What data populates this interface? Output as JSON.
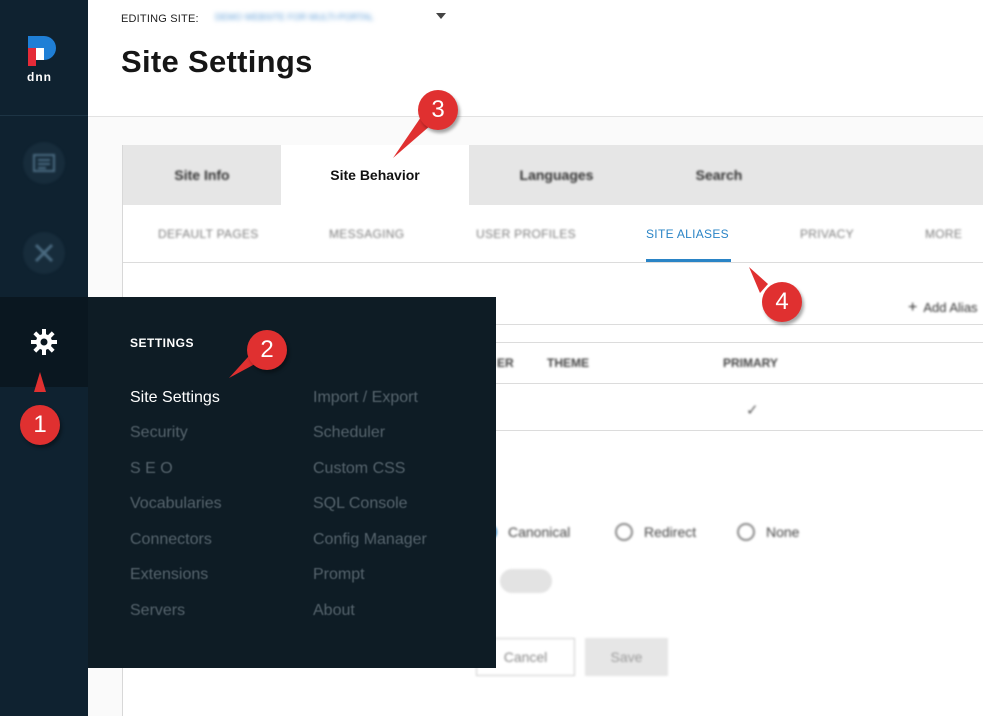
{
  "header": {
    "editing_label": "EDITING SITE:",
    "site_name": "DEMO WEBSITE FOR MULTI-PORTAL",
    "page_title": "Site Settings"
  },
  "logo": {
    "text": "DNN"
  },
  "rail": {
    "items": [
      {
        "icon": "content-pages-icon"
      },
      {
        "icon": "tools-icon"
      },
      {
        "icon": "gear-icon"
      }
    ]
  },
  "tabs": [
    "Site Info",
    "Site Behavior",
    "Languages",
    "Search"
  ],
  "subtabs": [
    "DEFAULT PAGES",
    "MESSAGING",
    "USER PROFILES",
    "SITE ALIASES",
    "PRIVACY",
    "MORE"
  ],
  "aliases": {
    "add_label": "Add Alias",
    "columns": [
      "ER",
      "THEME",
      "PRIMARY"
    ],
    "check": "✓"
  },
  "options": {
    "radios": [
      "Canonical",
      "Redirect",
      "None"
    ]
  },
  "buttons": {
    "cancel": "Cancel",
    "save": "Save"
  },
  "menu": {
    "title": "SETTINGS",
    "left": [
      "Site Settings",
      "Security",
      "S E O",
      "Vocabularies",
      "Connectors",
      "Extensions",
      "Servers"
    ],
    "right": [
      "Import / Export",
      "Scheduler",
      "Custom CSS",
      "SQL Console",
      "Config Manager",
      "Prompt",
      "About"
    ]
  },
  "annotations": [
    "1",
    "2",
    "3",
    "4"
  ],
  "colors": {
    "accent": "#2a84c6",
    "rail": "#0f2230",
    "menu": "#0e1c25",
    "badge": "#e03030"
  }
}
